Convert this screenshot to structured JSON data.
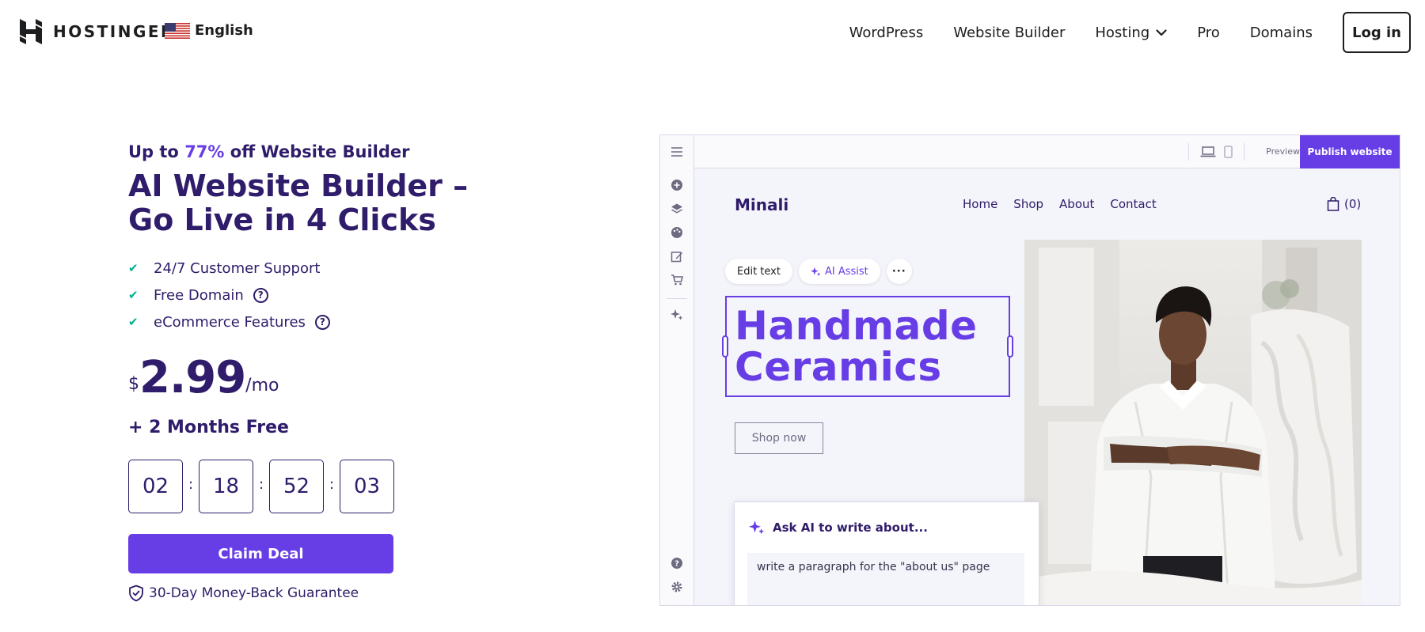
{
  "header": {
    "brand": "HOSTINGER",
    "language": "English",
    "nav": {
      "wordpress": "WordPress",
      "website_builder": "Website Builder",
      "hosting": "Hosting",
      "pro": "Pro",
      "domains": "Domains"
    },
    "login": "Log in"
  },
  "hero": {
    "promo_prefix": "Up to",
    "promo_discount": "77%",
    "promo_suffix": "off Website Builder",
    "title": "AI Website Builder – Go Live in 4 Clicks",
    "features": [
      "24/7 Customer Support",
      "Free Domain",
      "eCommerce Features"
    ],
    "price": {
      "currency": "$",
      "amount": "2.99",
      "period": "/mo"
    },
    "bonus": "+ 2 Months Free",
    "timer": [
      "02",
      "18",
      "52",
      "03"
    ],
    "cta": "Claim Deal",
    "guarantee": "30-Day Money-Back Guarantee"
  },
  "mockup": {
    "preview": "Preview",
    "publish": "Publish website",
    "site_name": "Minali",
    "site_nav": [
      "Home",
      "Shop",
      "About",
      "Contact"
    ],
    "cart_count": "(0)",
    "edit_text": "Edit text",
    "ai_assist": "AI Assist",
    "headline_line1": "Handmade",
    "headline_line2": "Ceramics",
    "shop_now": "Shop now",
    "ai_prompt_title": "Ask AI to write about...",
    "ai_prompt_value": "write a paragraph for the \"about us\" page"
  },
  "colors": {
    "primary": "#673de6",
    "dark_text": "#2f1c6a",
    "check": "#00b090"
  }
}
